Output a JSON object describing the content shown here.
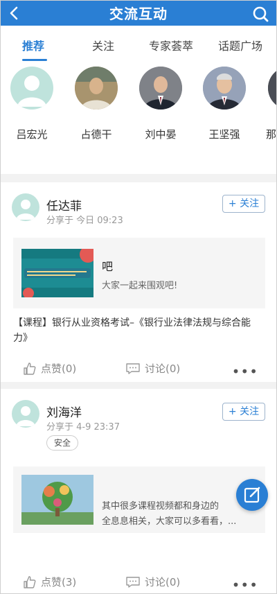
{
  "header": {
    "title": "交流互动"
  },
  "tabs": [
    {
      "label": "推荐"
    },
    {
      "label": "关注"
    },
    {
      "label": "专家荟萃"
    },
    {
      "label": "话题广场"
    }
  ],
  "experts": [
    {
      "name": "吕宏光"
    },
    {
      "name": "占德干"
    },
    {
      "name": "刘中晏"
    },
    {
      "name": "王坚强"
    },
    {
      "name": "那"
    }
  ],
  "posts": [
    {
      "author": "任达菲",
      "time": "分享于 今日 09:23",
      "follow_label": "关注",
      "card_title": "吧",
      "card_desc": "大家一起来围观吧!",
      "text": "【课程】银行从业资格考试–《银行业法律法规与综合能力》",
      "like_label": "点赞(0)",
      "comment_label": "讨论(0)"
    },
    {
      "author": "刘海洋",
      "time": "分享于 4-9 23:37",
      "follow_label": "关注",
      "tag": "安全",
      "card_desc_line1": "其中很多课程视频都和身边的",
      "card_desc_line2": "全息息相关，大家可以多看看，...",
      "like_label": "点赞(3)",
      "comment_label": "讨论(0)"
    }
  ],
  "colors": {
    "accent": "#2a7fd4"
  }
}
